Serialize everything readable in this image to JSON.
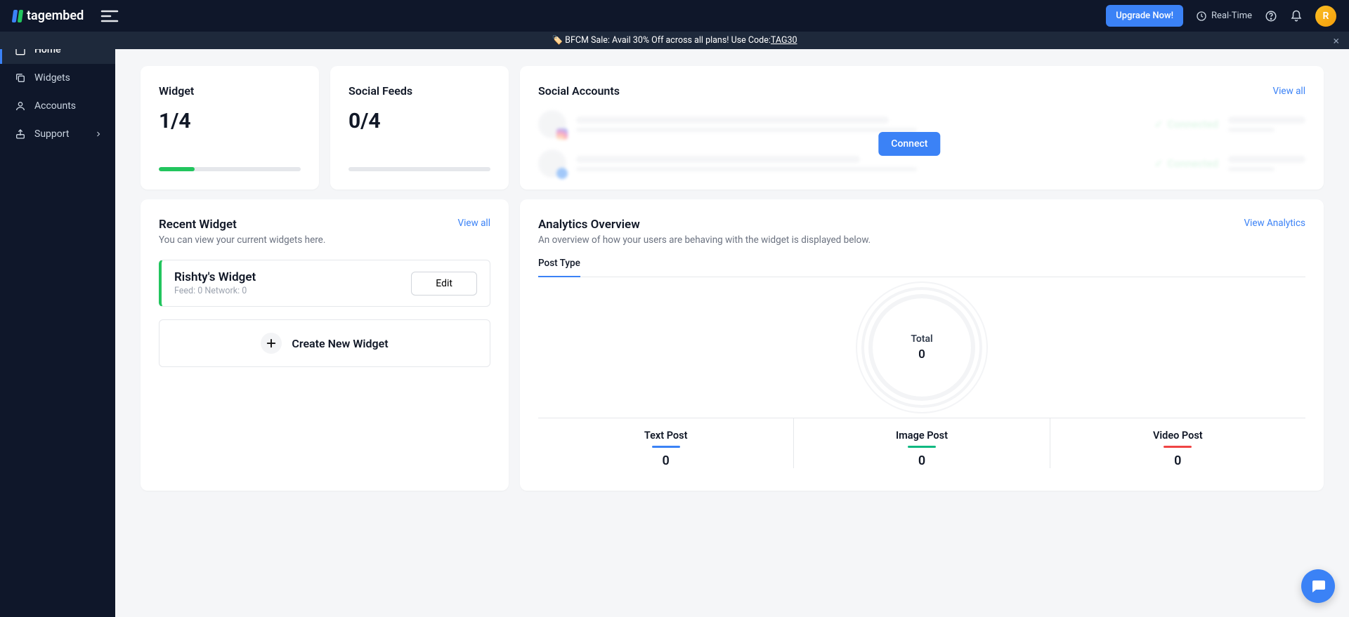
{
  "brand": "tagembed",
  "header": {
    "upgrade": "Upgrade Now!",
    "realtime": "Real-Time",
    "avatar_initial": "R"
  },
  "banner": {
    "emoji": "🏷️",
    "text": "BFCM Sale: Avail 30% Off across all plans! Use Code: ",
    "code": "TAG30"
  },
  "sidebar": {
    "home": "Home",
    "widgets": "Widgets",
    "accounts": "Accounts",
    "support": "Support"
  },
  "stats": {
    "widget_title": "Widget",
    "widget_value": "1/4",
    "widget_progress_pct": 25,
    "feeds_title": "Social Feeds",
    "feeds_value": "0/4",
    "feeds_progress_pct": 0
  },
  "social": {
    "title": "Social Accounts",
    "view_all": "View all",
    "connect": "Connect",
    "connected": "Connected"
  },
  "recent": {
    "title": "Recent Widget",
    "view_all": "View all",
    "subtitle": "You can view your current widgets here.",
    "widget_name": "Rishty's Widget",
    "widget_meta": "Feed: 0 Network: 0",
    "edit": "Edit",
    "create": "Create New Widget"
  },
  "analytics": {
    "title": "Analytics Overview",
    "view": "View Analytics",
    "subtitle": "An overview of how your users are behaving with the widget is displayed below.",
    "tab": "Post Type",
    "total_label": "Total",
    "total_value": "0",
    "text_post_label": "Text Post",
    "text_post_value": "0",
    "image_post_label": "Image Post",
    "image_post_value": "0",
    "video_post_label": "Video Post",
    "video_post_value": "0"
  },
  "chart_data": {
    "type": "pie",
    "title": "Post Type",
    "categories": [
      "Text Post",
      "Image Post",
      "Video Post"
    ],
    "values": [
      0,
      0,
      0
    ],
    "total": 0
  }
}
